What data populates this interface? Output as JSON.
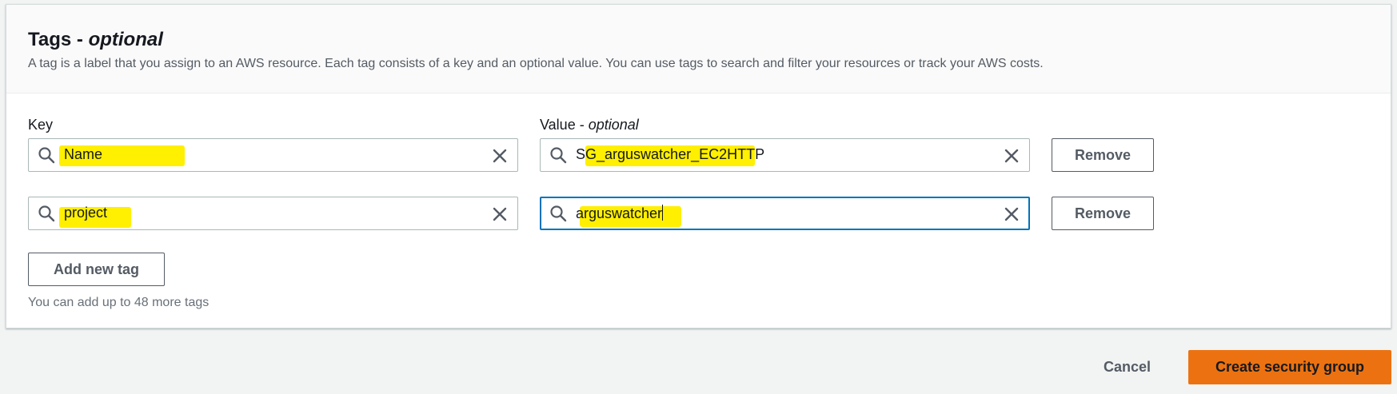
{
  "panel": {
    "title": "Tags - ",
    "title_optional": "optional",
    "description": "A tag is a label that you assign to an AWS resource. Each tag consists of a key and an optional value. You can use tags to search and filter your resources or track your AWS costs."
  },
  "columns": {
    "key_label": "Key",
    "value_label": "Value - ",
    "value_optional": "optional"
  },
  "tags": [
    {
      "key": "Name",
      "value": "SG_arguswatcher_EC2HTTP",
      "remove_label": "Remove"
    },
    {
      "key": "project",
      "value": "arguswatcher",
      "remove_label": "Remove"
    }
  ],
  "add_tag_label": "Add new tag",
  "limit_text": "You can add up to 48 more tags",
  "footer": {
    "cancel_label": "Cancel",
    "create_label": "Create security group"
  },
  "colors": {
    "primary": "#ec7211",
    "focus": "#0073bb",
    "highlight": "#ffef00"
  },
  "icons": [
    "search-icon",
    "close-icon"
  ]
}
